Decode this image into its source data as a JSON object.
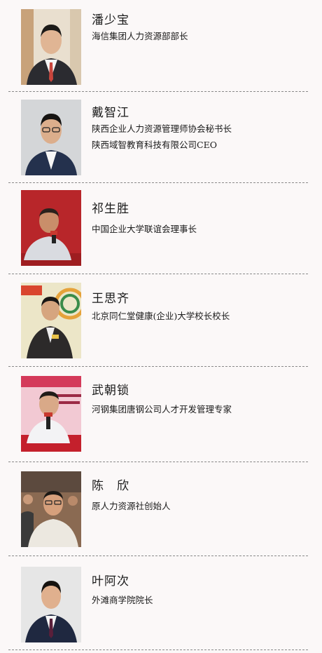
{
  "speakers": [
    {
      "name": "潘少宝",
      "titles": [
        "海信集团人力资源部部长"
      ]
    },
    {
      "name": "戴智江",
      "titles": [
        "陕西企业人力资源管理师协会秘书长",
        "陕西域智教育科技有限公司CEO"
      ]
    },
    {
      "name": "祁生胜",
      "titles": [
        "中国企业大学联谊会理事长"
      ]
    },
    {
      "name": "王思齐",
      "titles": [
        "北京同仁堂健康(企业)大学校长校长"
      ]
    },
    {
      "name": "武朝锁",
      "titles": [
        "河钢集团唐钢公司人才开发管理专家"
      ]
    },
    {
      "name": "陈　欣",
      "titles": [
        "原人力资源社创始人"
      ]
    },
    {
      "name": "叶阿次",
      "titles": [
        "外滩商学院院长"
      ]
    }
  ]
}
